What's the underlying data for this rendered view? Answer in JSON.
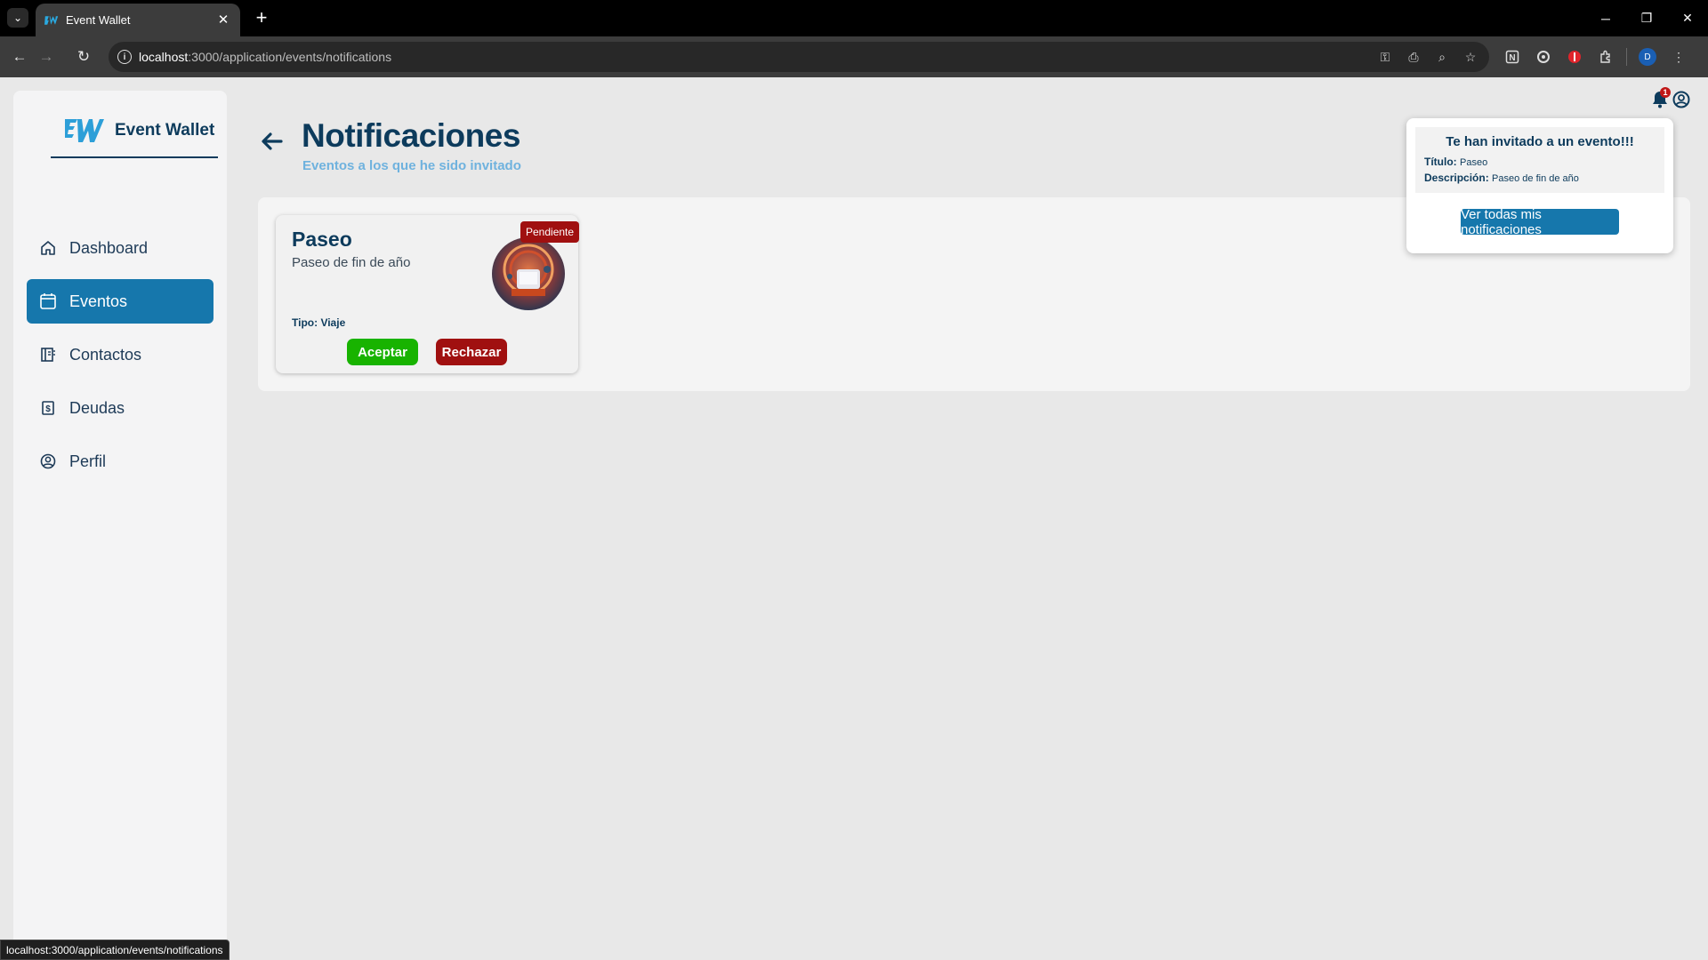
{
  "browser": {
    "tab_title": "Event Wallet",
    "url_host": "localhost",
    "url_path": ":3000/application/events/notifications",
    "profile_initial": "D",
    "status_bar_url": "localhost:3000/application/events/notifications"
  },
  "app": {
    "logo_text": "Event Wallet",
    "brand_color": "#1677ac",
    "navy_color": "#0d3b5c"
  },
  "sidebar": {
    "items": [
      {
        "label": "Dashboard",
        "icon": "home-icon"
      },
      {
        "label": "Eventos",
        "icon": "calendar-icon",
        "active": true
      },
      {
        "label": "Contactos",
        "icon": "contacts-icon"
      },
      {
        "label": "Deudas",
        "icon": "receipt-icon"
      },
      {
        "label": "Perfil",
        "icon": "user-circle-icon"
      }
    ]
  },
  "header": {
    "title": "Notificaciones",
    "subtitle": "Eventos a los que he sido invitado"
  },
  "event_card": {
    "title": "Paseo",
    "description": "Paseo de fin de año",
    "type_label": "Tipo: Viaje",
    "status": "Pendiente",
    "status_color": "#a01010",
    "accept_label": "Aceptar",
    "reject_label": "Rechazar"
  },
  "notifications": {
    "count": "1",
    "popup_title": "Te han invitado a un evento!!!",
    "title_label": "Título:",
    "title_value": "Paseo",
    "desc_label": "Descripción:",
    "desc_value": "Paseo de fin de año",
    "view_all_label": "Ver todas mis notificaciones"
  }
}
